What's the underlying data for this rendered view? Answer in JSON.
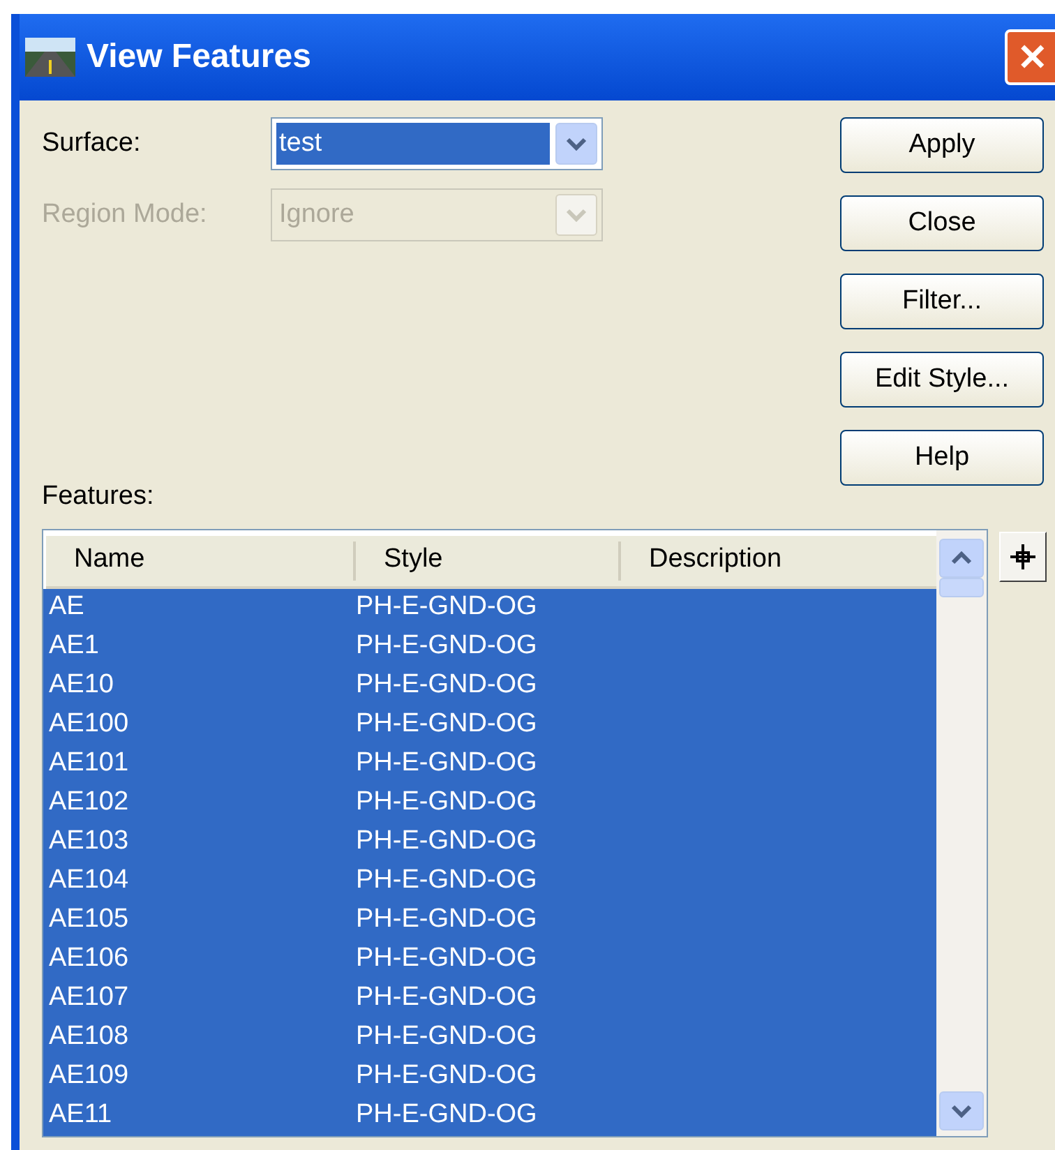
{
  "window": {
    "title": "View Features",
    "close": "✕"
  },
  "surface": {
    "label": "Surface:",
    "value": "test",
    "disabled": false
  },
  "region_mode": {
    "label": "Region Mode:",
    "value": "Ignore",
    "disabled": true
  },
  "buttons": [
    "Apply",
    "Close",
    "Filter...",
    "Edit Style...",
    "Help"
  ],
  "features": {
    "label": "Features:",
    "columns": [
      "Name",
      "Style",
      "Description"
    ],
    "rows": [
      {
        "name": "AE",
        "style": "PH-E-GND-OG",
        "selected": true
      },
      {
        "name": "AE1",
        "style": "PH-E-GND-OG",
        "selected": true
      },
      {
        "name": "AE10",
        "style": "PH-E-GND-OG",
        "selected": true
      },
      {
        "name": "AE100",
        "style": "PH-E-GND-OG",
        "selected": true
      },
      {
        "name": "AE101",
        "style": "PH-E-GND-OG",
        "selected": true
      },
      {
        "name": "AE102",
        "style": "PH-E-GND-OG",
        "selected": true
      },
      {
        "name": "AE103",
        "style": "PH-E-GND-OG",
        "selected": true
      },
      {
        "name": "AE104",
        "style": "PH-E-GND-OG",
        "selected": true
      },
      {
        "name": "AE105",
        "style": "PH-E-GND-OG",
        "selected": true
      },
      {
        "name": "AE106",
        "style": "PH-E-GND-OG",
        "selected": true
      },
      {
        "name": "AE107",
        "style": "PH-E-GND-OG",
        "selected": true
      },
      {
        "name": "AE108",
        "style": "PH-E-GND-OG",
        "selected": true
      },
      {
        "name": "AE109",
        "style": "PH-E-GND-OG",
        "selected": true
      },
      {
        "name": "AE11",
        "style": "PH-E-GND-OG",
        "selected": true
      }
    ]
  }
}
